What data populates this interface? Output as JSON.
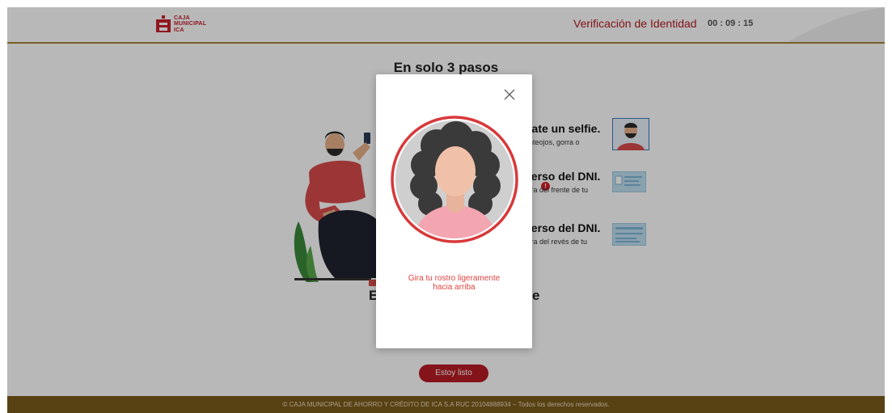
{
  "header": {
    "logo": {
      "line1": "CAJA",
      "line2": "MUNICIPAL",
      "line3": "ICA"
    },
    "title": "Verificación de Identidad",
    "timer": "00 : 09 : 15"
  },
  "main": {
    "title": "En solo 3 pasos",
    "steps": [
      {
        "title": "nate un selfie.",
        "desc1": "anteojos, gorra o",
        "desc2": "."
      },
      {
        "title": "verso del DNI.",
        "desc1": "tura del frente de tu"
      },
      {
        "title": "verso del DNI.",
        "desc1": "tura del revés de tu"
      }
    ],
    "info_badge": "!",
    "bottom_left": "E",
    "bottom_right": "e",
    "ready_button": "Estoy listo"
  },
  "footer": {
    "text": "© CAJA MUNICIPAL DE AHORRO Y CRÉDITO DE ICA S.A RUC 20104888934 – Todos los derechos reservados."
  },
  "modal": {
    "instruction_line1": "Gira tu rostro ligeramente",
    "instruction_line2": "hacia arriba"
  },
  "colors": {
    "brand_red": "#b81c25",
    "footer_brown": "#7a5a1a",
    "header_rule": "#a8843a",
    "instruction_red": "#e0433e"
  }
}
